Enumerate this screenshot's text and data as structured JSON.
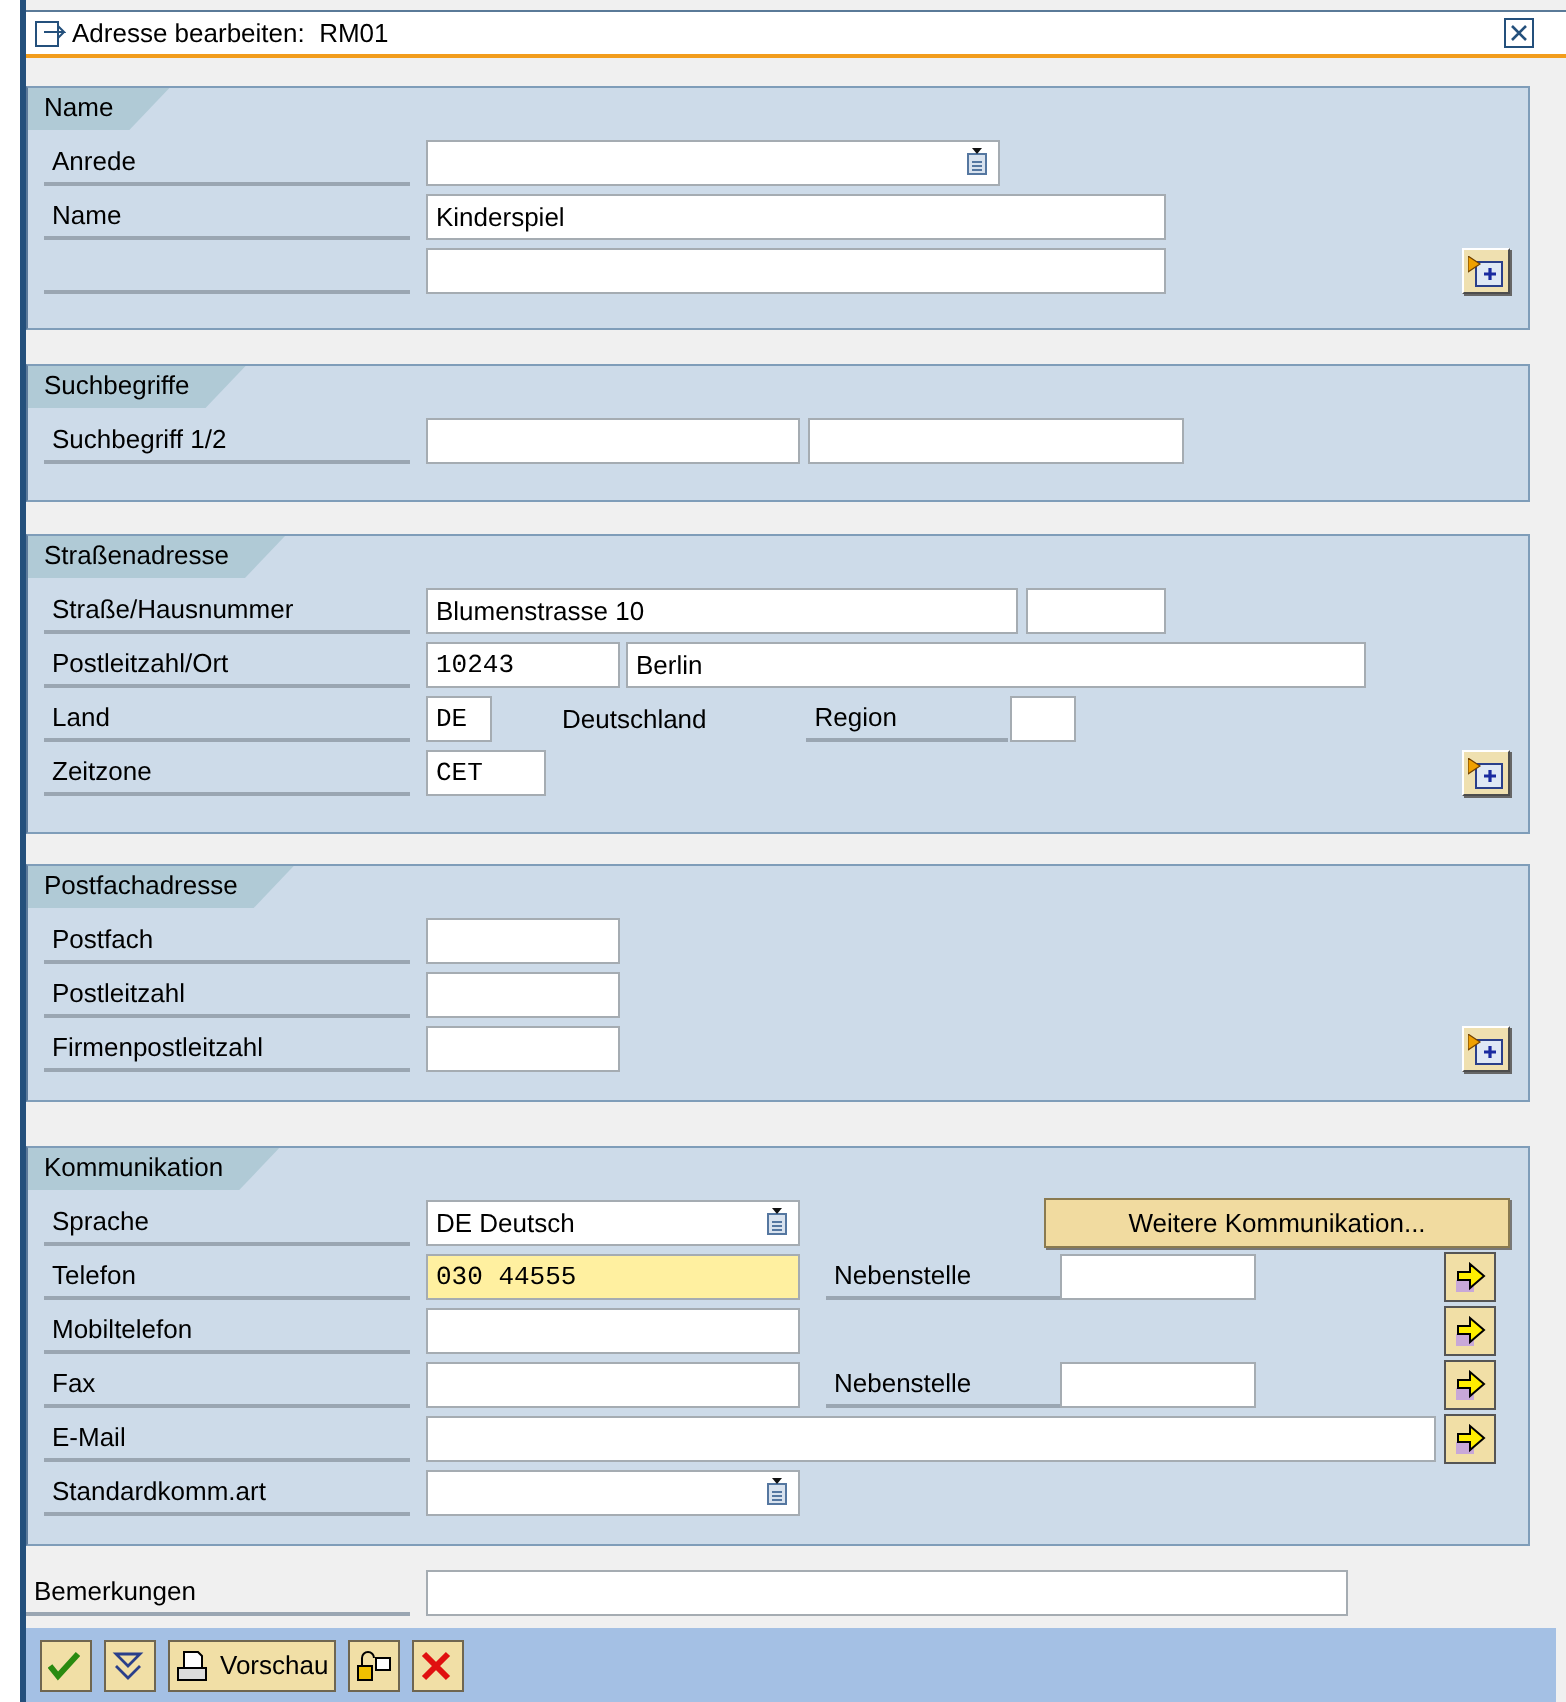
{
  "window": {
    "title": "Adresse bearbeiten:  RM01"
  },
  "name": {
    "title": "Name",
    "salutation": {
      "label": "Anrede"
    },
    "name1": {
      "label": "Name",
      "value": "Kinderspiel"
    }
  },
  "search_terms": {
    "title": "Suchbegriffe",
    "label": "Suchbegriff 1/2"
  },
  "street_address": {
    "title": "Straßenadresse",
    "street": {
      "label": "Straße/Hausnummer",
      "value": "Blumenstrasse 10"
    },
    "postal": {
      "label": "Postleitzahl/Ort",
      "postal_code": "10243",
      "city": "Berlin"
    },
    "country": {
      "label": "Land",
      "code": "DE",
      "name": "Deutschland",
      "region_label": "Region"
    },
    "time_zone": {
      "label": "Zeitzone",
      "value": "CET"
    }
  },
  "po_box_address": {
    "title": "Postfachadresse",
    "labels": [
      "Postfach",
      "Postleitzahl",
      "Firmenpostleitzahl"
    ]
  },
  "communication": {
    "title": "Kommunikation",
    "more_button": "Weitere Kommunikation...",
    "rows": [
      {
        "kind": "dropdown",
        "label": "Sprache",
        "value": "DE Deutsch"
      },
      {
        "kind": "number",
        "label": "Telefon",
        "value": "030 44555",
        "focused": true,
        "extension_label": "Nebenstelle"
      },
      {
        "kind": "number",
        "label": "Mobiltelefon",
        "focused": false
      },
      {
        "kind": "number",
        "label": "Fax",
        "focused": false,
        "extension_label": "Nebenstelle"
      },
      {
        "kind": "email",
        "label": "E-Mail",
        "focused": false
      },
      {
        "kind": "dropdown",
        "label": "Standardkomm.art"
      }
    ]
  },
  "remarks": {
    "label": "Bemerkungen"
  },
  "toolbar": [
    {
      "kind": "confirm"
    },
    {
      "kind": "collapse"
    },
    {
      "kind": "preview",
      "label": "Vorschau"
    },
    {
      "kind": "transport"
    },
    {
      "kind": "cancel"
    }
  ]
}
